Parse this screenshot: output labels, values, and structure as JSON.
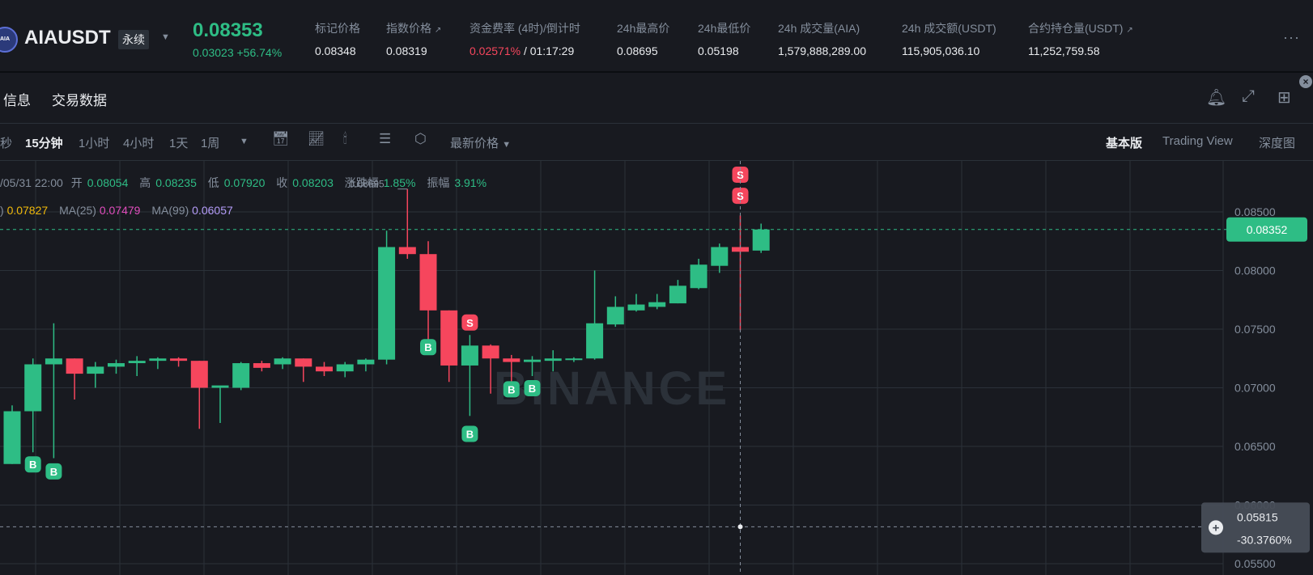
{
  "header": {
    "logo_text": "AIA",
    "symbol": "AIAUSDT",
    "contract_type": "永续",
    "last_price": "0.08353",
    "change_abs": "0.03023",
    "change_pct": "+56.74%",
    "stats": [
      {
        "label": "标记价格",
        "value": "0.08348"
      },
      {
        "label": "指数价格",
        "value": "0.08319"
      },
      {
        "label": "资金费率 (4时)/倒计时",
        "value": "0.02571%",
        "value2": " / 01:17:29"
      },
      {
        "label": "24h最高价",
        "value": "0.08695"
      },
      {
        "label": "24h最低价",
        "value": "0.05198"
      },
      {
        "label": "24h 成交量(AIA)",
        "value": "1,579,888,289.00"
      },
      {
        "label": "24h 成交额(USDT)",
        "value": "115,905,036.10"
      },
      {
        "label": "合约持仓量(USDT)",
        "value": "11,252,759.58"
      }
    ]
  },
  "tabs": {
    "info": "信息",
    "trade_data": "交易数据"
  },
  "toolbar": {
    "intervals": [
      "秒",
      "15分钟",
      "1小时",
      "4小时",
      "1天",
      "1周"
    ],
    "active_interval": "15分钟",
    "price_source": "最新价格",
    "views": [
      "基本版",
      "Trading View",
      "深度图"
    ],
    "active_view": "基本版"
  },
  "ohlc": {
    "time": "/05/31 22:00",
    "open_label": "开",
    "open": "0.08054",
    "high_label": "高",
    "high": "0.08235",
    "low_label": "低",
    "low": "0.07920",
    "close_label": "收",
    "close": "0.08203",
    "chg_label": "涨跌幅",
    "chg": "1.85%",
    "amp_label": "振幅",
    "amp": "3.91%"
  },
  "ma": {
    "ma7_label": ")",
    "ma7": "0.07827",
    "ma25_label": "MA(25)",
    "ma25": "0.07479",
    "ma99_label": "MA(99)",
    "ma99": "0.06057"
  },
  "colors": {
    "up": "#2ebd85",
    "down": "#f6465d",
    "bg": "#181a20",
    "grid": "#2b3139",
    "ma7": "#f0b90b",
    "ma25": "#e14dbd",
    "ma99": "#b49cf8"
  },
  "chart_data": {
    "type": "candlestick",
    "watermark": "BINANCE",
    "y_ticks": [
      "0.08500",
      "0.08000",
      "0.07500",
      "0.07000",
      "0.06500",
      "0.06000",
      "0.05500"
    ],
    "current_price_label": "0.08352",
    "crosshair_price": "0.05815",
    "crosshair_pct": "-30.3760%",
    "high_marker": "0.08695",
    "candles": [
      {
        "o": 0.0635,
        "h": 0.0685,
        "l": 0.0635,
        "c": 0.068
      },
      {
        "o": 0.068,
        "h": 0.0725,
        "l": 0.0645,
        "c": 0.072
      },
      {
        "o": 0.072,
        "h": 0.0755,
        "l": 0.064,
        "c": 0.0725
      },
      {
        "o": 0.0725,
        "h": 0.0725,
        "l": 0.069,
        "c": 0.0712
      },
      {
        "o": 0.0712,
        "h": 0.0722,
        "l": 0.07,
        "c": 0.0718
      },
      {
        "o": 0.0718,
        "h": 0.0724,
        "l": 0.0712,
        "c": 0.0721
      },
      {
        "o": 0.0721,
        "h": 0.0727,
        "l": 0.071,
        "c": 0.0723
      },
      {
        "o": 0.0723,
        "h": 0.0726,
        "l": 0.0716,
        "c": 0.0725
      },
      {
        "o": 0.0725,
        "h": 0.0726,
        "l": 0.0718,
        "c": 0.0723
      },
      {
        "o": 0.0723,
        "h": 0.0723,
        "l": 0.0665,
        "c": 0.07
      },
      {
        "o": 0.07,
        "h": 0.07,
        "l": 0.067,
        "c": 0.0702
      },
      {
        "o": 0.07,
        "h": 0.0722,
        "l": 0.0698,
        "c": 0.0721
      },
      {
        "o": 0.0721,
        "h": 0.0723,
        "l": 0.0714,
        "c": 0.0717
      },
      {
        "o": 0.072,
        "h": 0.0726,
        "l": 0.0716,
        "c": 0.0725
      },
      {
        "o": 0.0725,
        "h": 0.0725,
        "l": 0.0705,
        "c": 0.0718
      },
      {
        "o": 0.0718,
        "h": 0.0722,
        "l": 0.071,
        "c": 0.0714
      },
      {
        "o": 0.0714,
        "h": 0.0722,
        "l": 0.0709,
        "c": 0.072
      },
      {
        "o": 0.072,
        "h": 0.0725,
        "l": 0.0714,
        "c": 0.0724
      },
      {
        "o": 0.0724,
        "h": 0.0834,
        "l": 0.072,
        "c": 0.082
      },
      {
        "o": 0.082,
        "h": 0.08695,
        "l": 0.081,
        "c": 0.0814
      },
      {
        "o": 0.0814,
        "h": 0.0825,
        "l": 0.074,
        "c": 0.0766
      },
      {
        "o": 0.0766,
        "h": 0.0766,
        "l": 0.0705,
        "c": 0.0719
      },
      {
        "o": 0.0719,
        "h": 0.0745,
        "l": 0.0676,
        "c": 0.0736
      },
      {
        "o": 0.0736,
        "h": 0.0737,
        "l": 0.0695,
        "c": 0.0725
      },
      {
        "o": 0.0725,
        "h": 0.0728,
        "l": 0.0705,
        "c": 0.0722
      },
      {
        "o": 0.0722,
        "h": 0.0727,
        "l": 0.071,
        "c": 0.0724
      },
      {
        "o": 0.0723,
        "h": 0.0732,
        "l": 0.0714,
        "c": 0.0725
      },
      {
        "o": 0.0724,
        "h": 0.0726,
        "l": 0.0722,
        "c": 0.0725
      },
      {
        "o": 0.0725,
        "h": 0.08,
        "l": 0.0724,
        "c": 0.0755
      },
      {
        "o": 0.0754,
        "h": 0.0778,
        "l": 0.0752,
        "c": 0.0769
      },
      {
        "o": 0.0766,
        "h": 0.078,
        "l": 0.0765,
        "c": 0.0771
      },
      {
        "o": 0.0769,
        "h": 0.078,
        "l": 0.0767,
        "c": 0.0773
      },
      {
        "o": 0.0772,
        "h": 0.0792,
        "l": 0.0772,
        "c": 0.0787
      },
      {
        "o": 0.0785,
        "h": 0.081,
        "l": 0.0784,
        "c": 0.0805
      },
      {
        "o": 0.0804,
        "h": 0.0823,
        "l": 0.0798,
        "c": 0.082
      },
      {
        "o": 0.082,
        "h": 0.0847,
        "l": 0.0749,
        "c": 0.0816
      },
      {
        "o": 0.0817,
        "h": 0.084,
        "l": 0.0815,
        "c": 0.0835
      }
    ],
    "markers": [
      {
        "i": 1,
        "type": "B",
        "price": 0.0634
      },
      {
        "i": 2,
        "type": "B",
        "price": 0.0628
      },
      {
        "i": 20,
        "type": "B",
        "price": 0.0734
      },
      {
        "i": 22,
        "type": "S",
        "price": 0.0755
      },
      {
        "i": 22,
        "type": "B",
        "price": 0.066
      },
      {
        "i": 24,
        "type": "B",
        "price": 0.0698
      },
      {
        "i": 25,
        "type": "B",
        "price": 0.0699
      },
      {
        "i": 35,
        "type": "S",
        "price": 0.0863
      },
      {
        "i": 35,
        "type": "S",
        "price": 0.0881
      }
    ]
  }
}
